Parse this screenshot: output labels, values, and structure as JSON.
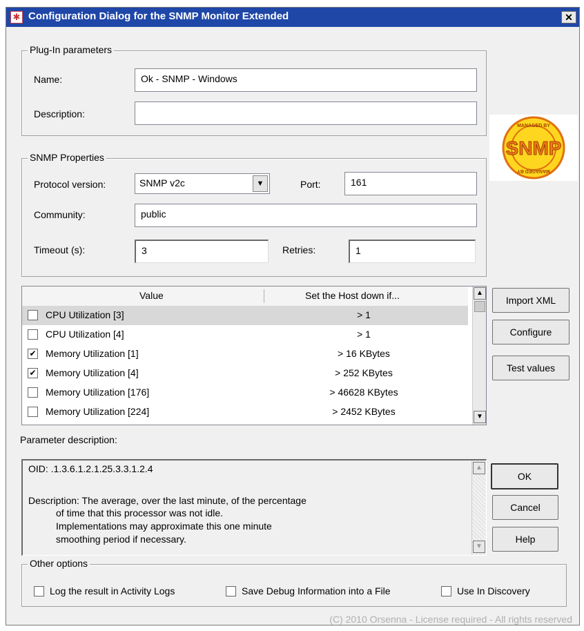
{
  "window": {
    "title": "Configuration Dialog for the SNMP Monitor Extended",
    "close_glyph": "✕"
  },
  "plugin_params": {
    "group_label": "Plug-In parameters",
    "name_label": "Name:",
    "name_value": "Ok - SNMP - Windows",
    "description_label": "Description:",
    "description_value": ""
  },
  "snmp": {
    "group_label": "SNMP Properties",
    "protocol_label": "Protocol version:",
    "protocol_value": "SNMP v2c",
    "port_label": "Port:",
    "port_value": "161",
    "community_label": "Community:",
    "community_value": "public",
    "timeout_label": "Timeout (s):",
    "timeout_value": "3",
    "retries_label": "Retries:",
    "retries_value": "1"
  },
  "logo": {
    "text": "SNMP",
    "ring_text_top": "MANAGED BY",
    "ring_text_bottom": "MANAGED BY"
  },
  "list": {
    "columns": [
      "Value",
      "Set the Host down if..."
    ],
    "rows": [
      {
        "label": "CPU Utilization [3]",
        "condition": "> 1",
        "checked": false,
        "selected": true
      },
      {
        "label": "CPU Utilization [4]",
        "condition": "> 1",
        "checked": false,
        "selected": false
      },
      {
        "label": "Memory Utilization [1]",
        "condition": "> 16 KBytes",
        "checked": true,
        "selected": false
      },
      {
        "label": "Memory Utilization [4]",
        "condition": "> 252 KBytes",
        "checked": true,
        "selected": false
      },
      {
        "label": "Memory Utilization [176]",
        "condition": "> 46628 KBytes",
        "checked": false,
        "selected": false
      },
      {
        "label": "Memory Utilization [224]",
        "condition": "> 2452 KBytes",
        "checked": false,
        "selected": false
      }
    ]
  },
  "side_buttons": {
    "import_xml": "Import XML",
    "configure": "Configure",
    "test_values": "Test values"
  },
  "param_desc": {
    "label": "Parameter description:",
    "lines": [
      "OID: .1.3.6.1.2.1.25.3.3.1.2.4",
      "",
      "Description: The average, over the last minute, of the percentage",
      "of time that this processor was not idle.",
      "Implementations may approximate this one minute",
      "smoothing period if necessary."
    ]
  },
  "dialog_buttons": {
    "ok": "OK",
    "cancel": "Cancel",
    "help": "Help"
  },
  "other_options": {
    "group_label": "Other options",
    "log_activity": "Log the result in Activity Logs",
    "save_debug": "Save Debug Information into a File",
    "use_discovery": "Use In Discovery"
  },
  "footer": {
    "copyright": "(C) 2010 Orsenna - License required - All rights reserved"
  },
  "colors": {
    "titlebar": "#1f47a8",
    "logo_orange": "#f07a18",
    "logo_yellow": "#ffd61f"
  }
}
